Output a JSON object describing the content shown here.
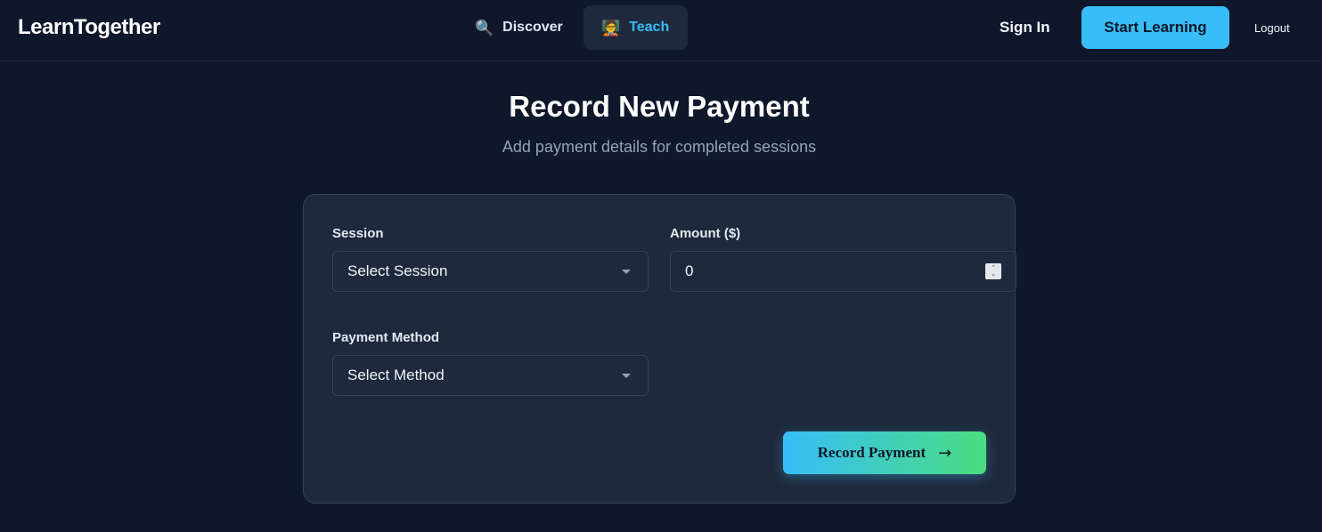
{
  "header": {
    "logo": "LearnTogether",
    "nav": [
      {
        "label": "Discover",
        "icon": "magnifier-icon",
        "glyph": "🔍"
      },
      {
        "label": "Teach",
        "icon": "teacher-icon",
        "glyph": "🧑‍🏫"
      }
    ],
    "sign_in": "Sign In",
    "start_learning": "Start Learning",
    "logout": "Logout"
  },
  "page": {
    "title": "Record New Payment",
    "subtitle": "Add payment details for completed sessions"
  },
  "form": {
    "session": {
      "label": "Session",
      "value": "Select Session"
    },
    "amount": {
      "label": "Amount ($)",
      "value": "0"
    },
    "payment_method": {
      "label": "Payment Method",
      "value": "Select Method"
    },
    "submit": {
      "label": "Record Payment",
      "arrow": "→"
    }
  },
  "colors": {
    "background": "#0f172a",
    "card": "#1e293b",
    "accent": "#38bdf8",
    "accent_green": "#4ade80"
  }
}
